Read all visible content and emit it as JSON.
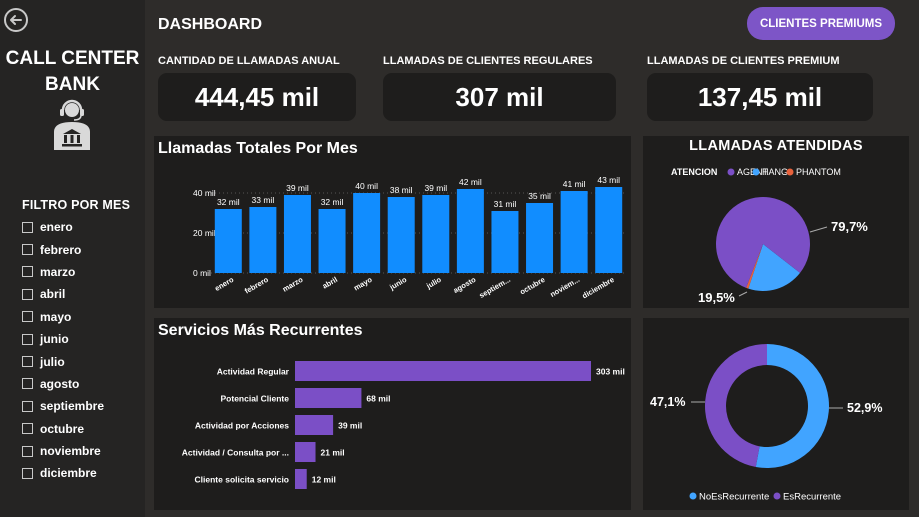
{
  "sidebar": {
    "title_line1": "CALL CENTER",
    "title_line2": "BANK",
    "filter_title": "FILTRO POR MES",
    "months": [
      "enero",
      "febrero",
      "marzo",
      "abril",
      "mayo",
      "junio",
      "julio",
      "agosto",
      "septiembre",
      "octubre",
      "noviembre",
      "diciembre"
    ]
  },
  "header": {
    "title": "DASHBOARD",
    "premium_button": "CLIENTES PREMIUMS"
  },
  "kpis": [
    {
      "label": "CANTIDAD DE LLAMADAS ANUAL",
      "value": "444,45 mil"
    },
    {
      "label": "LLAMADAS DE CLIENTES REGULARES",
      "value": "307 mil"
    },
    {
      "label": "LLAMADAS DE CLIENTES PREMIUM",
      "value": "137,45 mil"
    }
  ],
  "colors": {
    "bar_blue": "#118dff",
    "purple": "#7b4fc6",
    "light_blue": "#41a4ff",
    "phantom": "#e8623c"
  },
  "chart_data": [
    {
      "type": "bar",
      "title": "Llamadas Totales Por Mes",
      "categories": [
        "enero",
        "febrero",
        "marzo",
        "abril",
        "mayo",
        "junio",
        "julio",
        "agosto",
        "septiem...",
        "octubre",
        "noviem...",
        "diciembre"
      ],
      "values": [
        32,
        33,
        39,
        32,
        40,
        38,
        39,
        42,
        31,
        35,
        41,
        43
      ],
      "data_labels": [
        "32 mil",
        "33 mil",
        "39 mil",
        "32 mil",
        "40 mil",
        "38 mil",
        "39 mil",
        "42 mil",
        "31 mil",
        "35 mil",
        "41 mil",
        "43 mil"
      ],
      "yticks": [
        "0 mil",
        "20 mil",
        "40 mil"
      ],
      "ylim": [
        0,
        45
      ]
    },
    {
      "type": "pie",
      "title": "LLAMADAS ATENDIDAS",
      "legend_title": "ATENCION",
      "labels": [
        "AGENT",
        "HANG",
        "PHANTOM"
      ],
      "values": [
        79.7,
        19.5,
        0.8
      ],
      "data_labels": [
        "79,7%",
        "19,5%"
      ]
    },
    {
      "type": "bar",
      "orientation": "horizontal",
      "title": "Servicios Más Recurrentes",
      "categories": [
        "Actividad Regular",
        "Potencial Cliente",
        "Actividad por Acciones",
        "Actividad / Consulta por ...",
        "Cliente solicita servicio"
      ],
      "values": [
        303,
        68,
        39,
        21,
        12
      ],
      "data_labels": [
        "303 mil",
        "68 mil",
        "39 mil",
        "21 mil",
        "12 mil"
      ]
    },
    {
      "type": "pie",
      "subtype": "donut",
      "labels": [
        "NoEsRecurrente",
        "EsRecurrente"
      ],
      "values": [
        52.9,
        47.1
      ],
      "data_labels": [
        "52,9%",
        "47,1%"
      ]
    }
  ]
}
